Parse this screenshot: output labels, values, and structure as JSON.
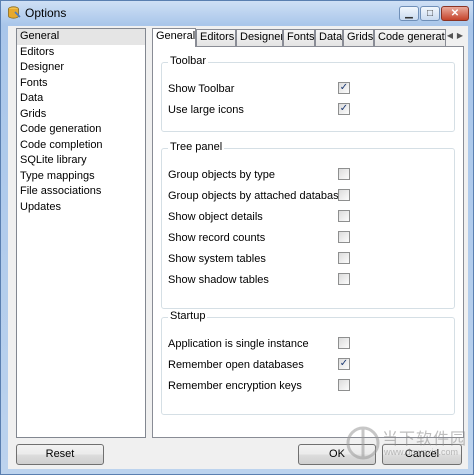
{
  "window": {
    "title": "Options"
  },
  "sidebar": {
    "items": [
      {
        "label": "General",
        "selected": true
      },
      {
        "label": "Editors"
      },
      {
        "label": "Designer"
      },
      {
        "label": "Fonts"
      },
      {
        "label": "Data"
      },
      {
        "label": "Grids"
      },
      {
        "label": "Code generation"
      },
      {
        "label": "Code completion"
      },
      {
        "label": "SQLite library"
      },
      {
        "label": "Type mappings"
      },
      {
        "label": "File associations"
      },
      {
        "label": "Updates"
      }
    ]
  },
  "tabs": [
    {
      "label": "General",
      "active": true
    },
    {
      "label": "Editors"
    },
    {
      "label": "Designer"
    },
    {
      "label": "Fonts"
    },
    {
      "label": "Data"
    },
    {
      "label": "Grids"
    },
    {
      "label": "Code generatio"
    }
  ],
  "groups": {
    "toolbar": {
      "title": "Toolbar",
      "options": [
        {
          "label": "Show Toolbar",
          "checked": true
        },
        {
          "label": "Use large icons",
          "checked": true
        }
      ]
    },
    "tree_panel": {
      "title": "Tree panel",
      "options": [
        {
          "label": "Group objects by type",
          "checked": false
        },
        {
          "label": "Group objects by attached databases",
          "checked": false
        },
        {
          "label": "Show object details",
          "checked": false
        },
        {
          "label": "Show record counts",
          "checked": false
        },
        {
          "label": "Show system tables",
          "checked": false
        },
        {
          "label": "Show shadow tables",
          "checked": false
        }
      ]
    },
    "startup": {
      "title": "Startup",
      "options": [
        {
          "label": "Application is single instance",
          "checked": false
        },
        {
          "label": "Remember open databases",
          "checked": true
        },
        {
          "label": "Remember encryption keys",
          "checked": false
        }
      ]
    }
  },
  "footer": {
    "reset_label": "Reset",
    "ok_label": "OK",
    "cancel_label": "Cancel"
  },
  "watermark": {
    "text": "当下软件园",
    "subtext": "www.downxia.com"
  },
  "colors": {
    "title_bar": "#bcd3ee",
    "client_bg": "#f0f0f0",
    "check": "#1c3a73"
  },
  "icons": {
    "app": "database-app-icon",
    "checkmark": "✓"
  }
}
